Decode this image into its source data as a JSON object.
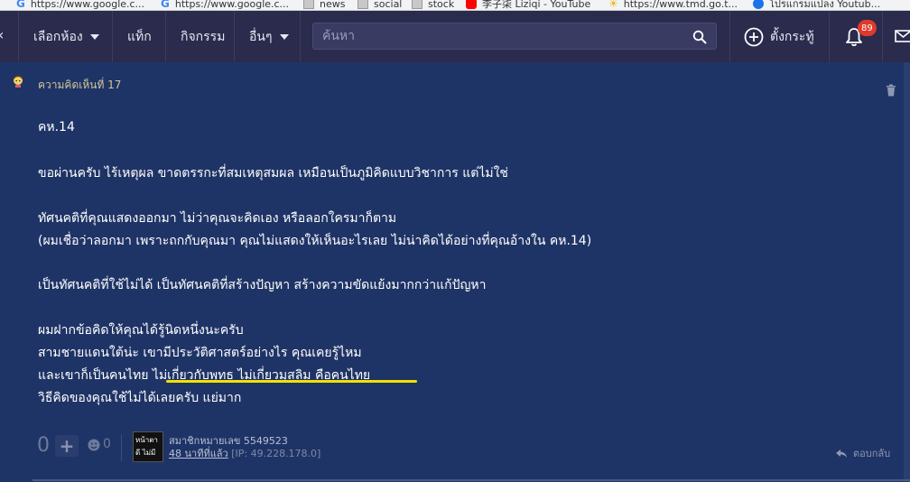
{
  "bookmarks": [
    {
      "label": "https://www.google.c...",
      "icon": "google-icon"
    },
    {
      "label": "https://www.google.c...",
      "icon": "google-icon"
    },
    {
      "label": "news",
      "icon": "folder-icon"
    },
    {
      "label": "social",
      "icon": "folder-icon"
    },
    {
      "label": "stock",
      "icon": "folder-icon"
    },
    {
      "label": "李子柒 Liziqi - YouTube",
      "icon": "youtube-icon"
    },
    {
      "label": "https://www.tmd.go.t...",
      "icon": "sun-icon"
    },
    {
      "label": "โปรแกรมแปลง Youtub...",
      "icon": "app-icon"
    }
  ],
  "nav": {
    "rooms": "เลือกห้อง",
    "tag": "แท็ก",
    "activities": "กิจกรรม",
    "more": "อื่นๆ",
    "search_placeholder": "ค้นหา",
    "new_topic": "ตั้งกระทู้",
    "notifications_count": "89"
  },
  "post": {
    "comment_number": "ความคิดเห็นที่ 17",
    "lines": [
      "คห.14",
      "ขอผ่านครับ  ไร้เหตุผล  ขาดตรรกะที่สมเหตุสมผล  เหมือนเป็นภูมิคิดแบบวิชาการ  แต่ไม่ใช่",
      "ทัศนคติที่คุณแสดงออกมา  ไม่ว่าคุณจะคิดเอง หรือลอกใครมาก็ตาม",
      "(ผมเชื่อว่าลอกมา  เพราะถกกับคุณมา คุณไม่แสดงให้เห็นอะไรเลย  ไม่น่าคิดได้อย่างที่คุณอ้างใน คห.14)",
      "เป็นทัศนคติที่ใช้ไม่ได้   เป็นทัศนคติที่สร้างปัญหา สร้างความขัดแย้งมากกว่าแก้ปัญหา",
      "ผมฝากข้อคิดให้คุณได้รู้นิดหนึ่งนะครับ",
      "สามชายแดนใต้น่ะ  เขามีประวัติศาสตร์อย่างไร  คุณเคยรู้ไหม",
      "และเขาก็เป็นคนไทย  ไม่เกี่ยวกับพุทธ ไม่เกี่ยวมุสลิม  คือคนไทย",
      "วิธีคิดของคุณใช้ไม่ได้เลยครับ  แย่มาก"
    ],
    "vote_count": "0",
    "emoji_count": "0",
    "avatar_text": "หน้าตาดี ไม่มีแฟน",
    "member": "สมาชิกหมายเลข 5549523",
    "time": "48 นาทีที่แล้ว",
    "ip": "[IP: 49.228.178.0]",
    "reply": "ตอบกลับ"
  },
  "colors": {
    "background": "#1f3466",
    "nav": "#2a2b4d",
    "highlight_underline": "#f2e200",
    "badge": "#e0392b"
  }
}
